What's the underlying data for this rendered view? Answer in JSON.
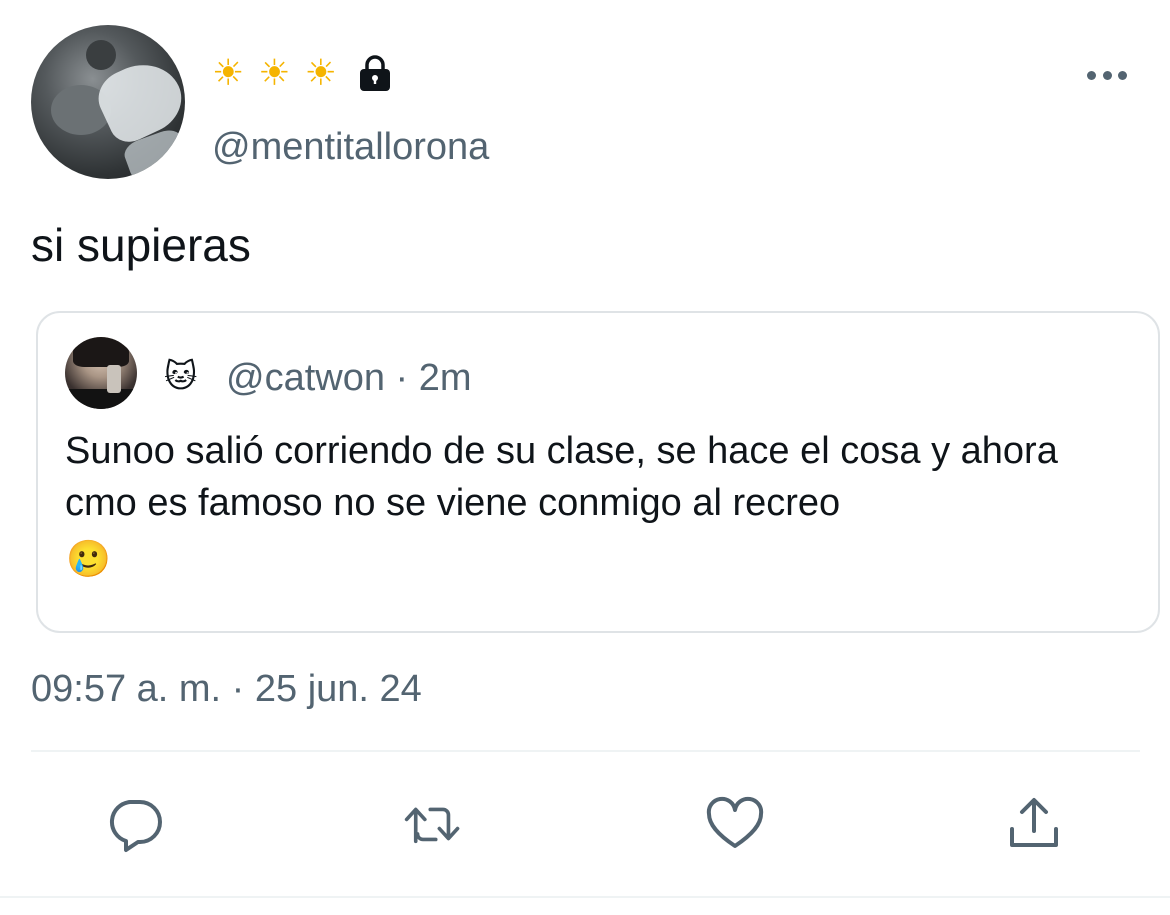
{
  "author": {
    "display_name_emoji": "☀️ ☀️ ☀️",
    "sun_icons": [
      "☀",
      "☀",
      "☀"
    ],
    "protected_icon": "lock-icon",
    "handle": "@mentitallorona"
  },
  "tweet": {
    "text": "si supieras",
    "timestamp": "09:57 a. m. · 25 jun. 24"
  },
  "quoted_tweet": {
    "display_name_emoji": "🐱",
    "handle_and_time": "@catwon · 2m",
    "text": "Sunoo salió corriendo de su clase, se hace el cosa y ahora cmo es famoso no se viene conmigo al recreo",
    "trailing_emoji": "🥲"
  },
  "actions": [
    "reply-icon",
    "retweet-icon",
    "like-icon",
    "share-icon"
  ],
  "colors": {
    "text_primary": "#0f1419",
    "text_secondary": "#536471",
    "border": "#dfe3e6"
  }
}
